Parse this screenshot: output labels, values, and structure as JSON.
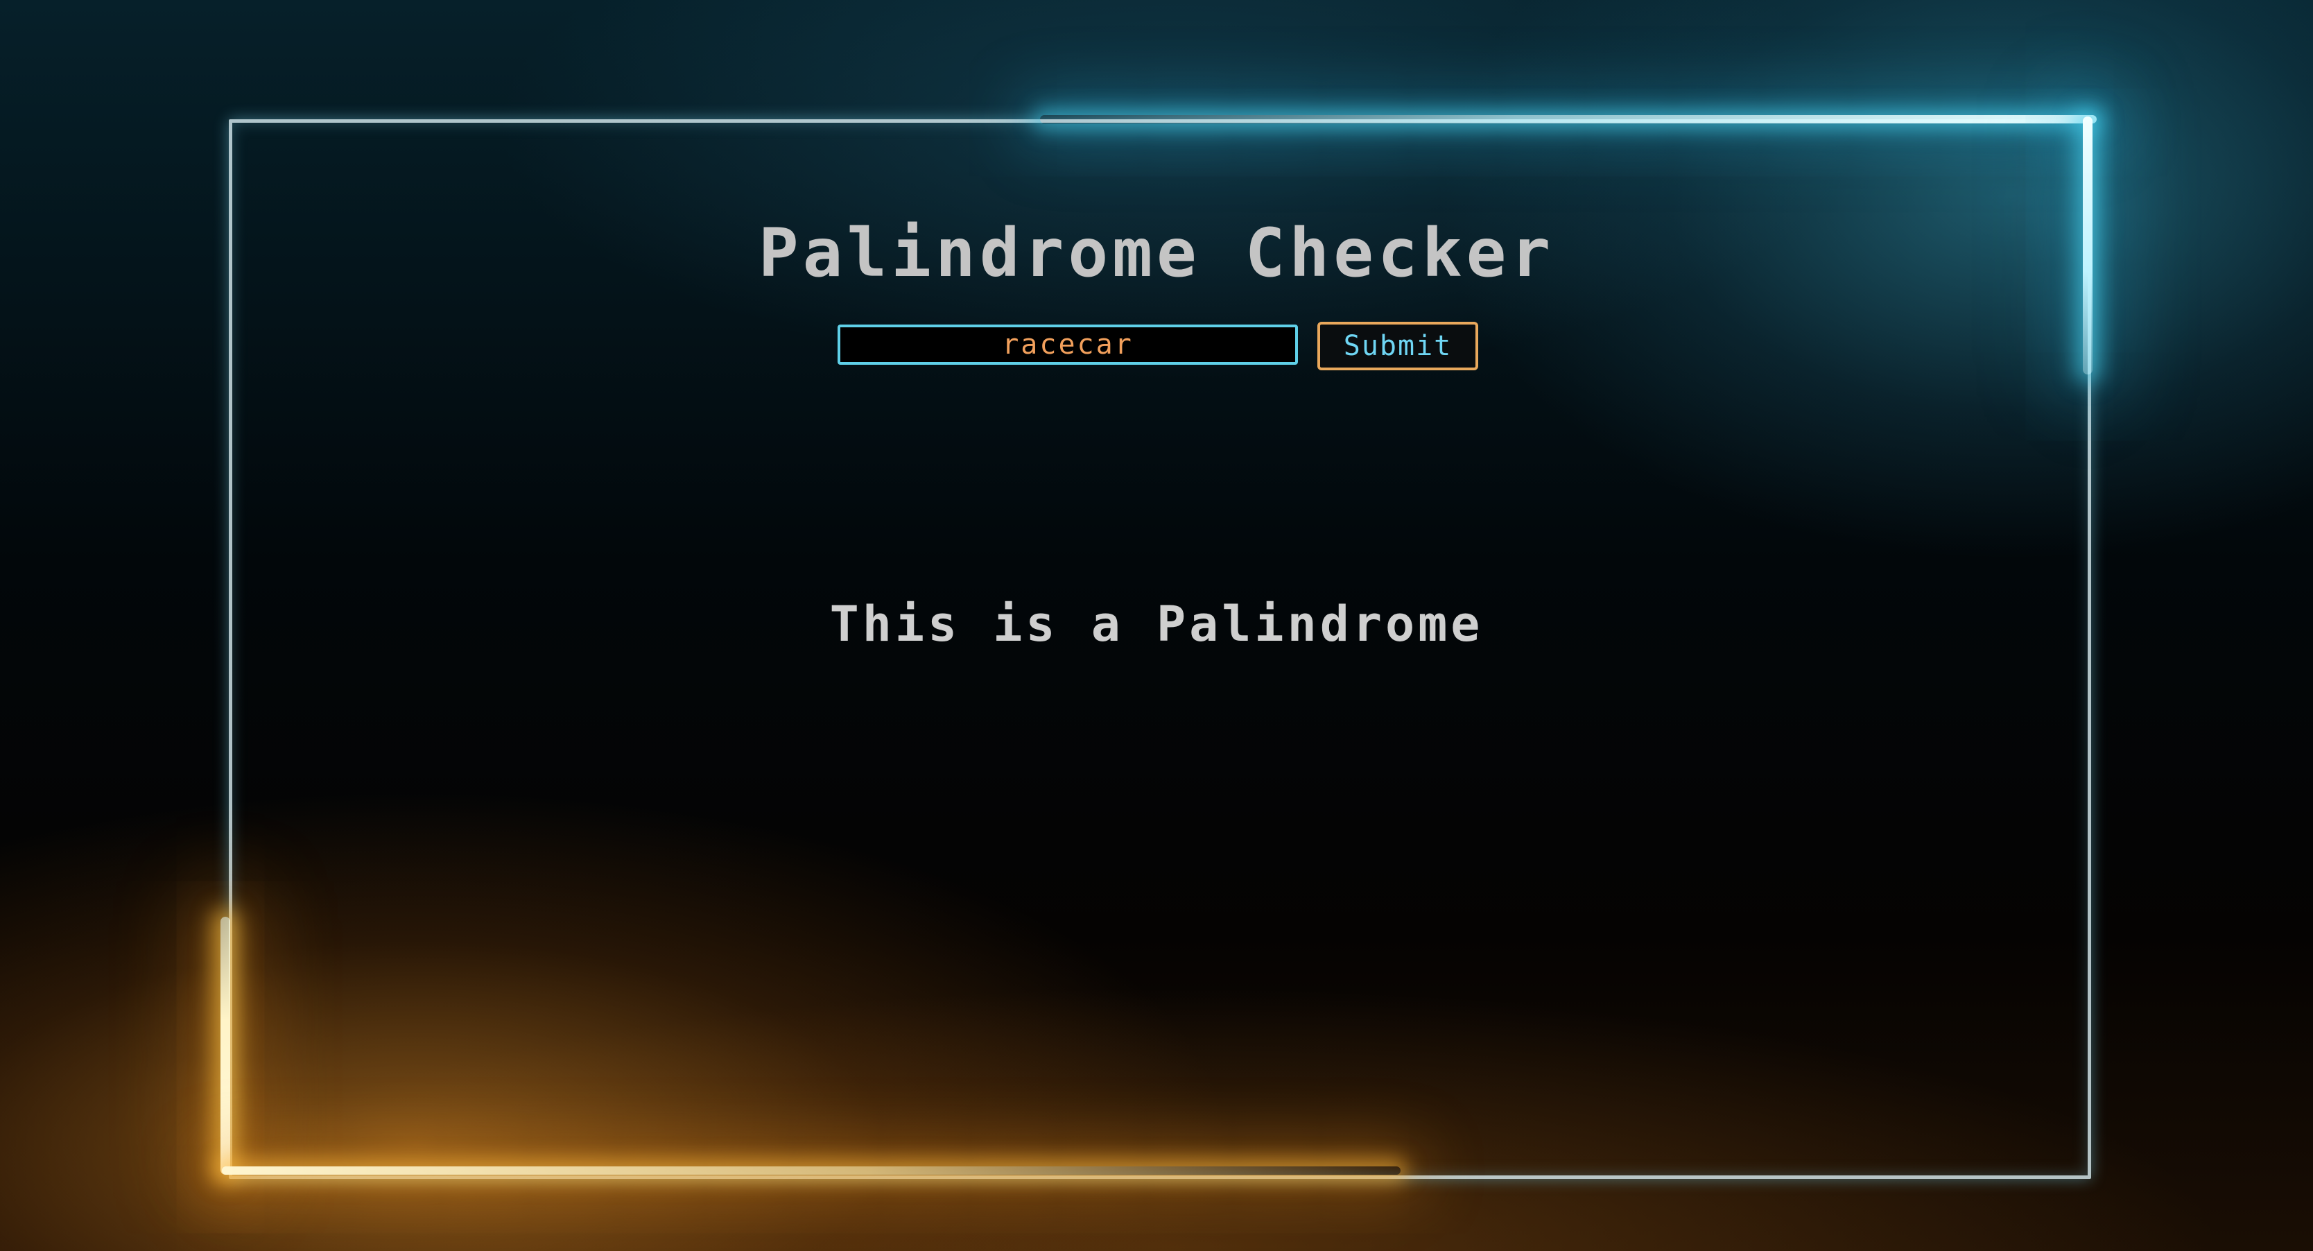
{
  "app": {
    "title": "Palindrome Checker"
  },
  "form": {
    "input_value": "racecar",
    "submit_label": "Submit"
  },
  "result": {
    "message": "This is a Palindrome"
  },
  "colors": {
    "background": "#030507",
    "frame_glow_cyan": "#46d2f0",
    "frame_glow_orange": "#ffb93c",
    "title_text": "#c4c4c4",
    "input_border": "#5fd0e8",
    "input_text": "#f2a05c",
    "button_border": "#e9a85c",
    "button_text": "#6fd6f4",
    "result_text": "#cfcfcf"
  }
}
